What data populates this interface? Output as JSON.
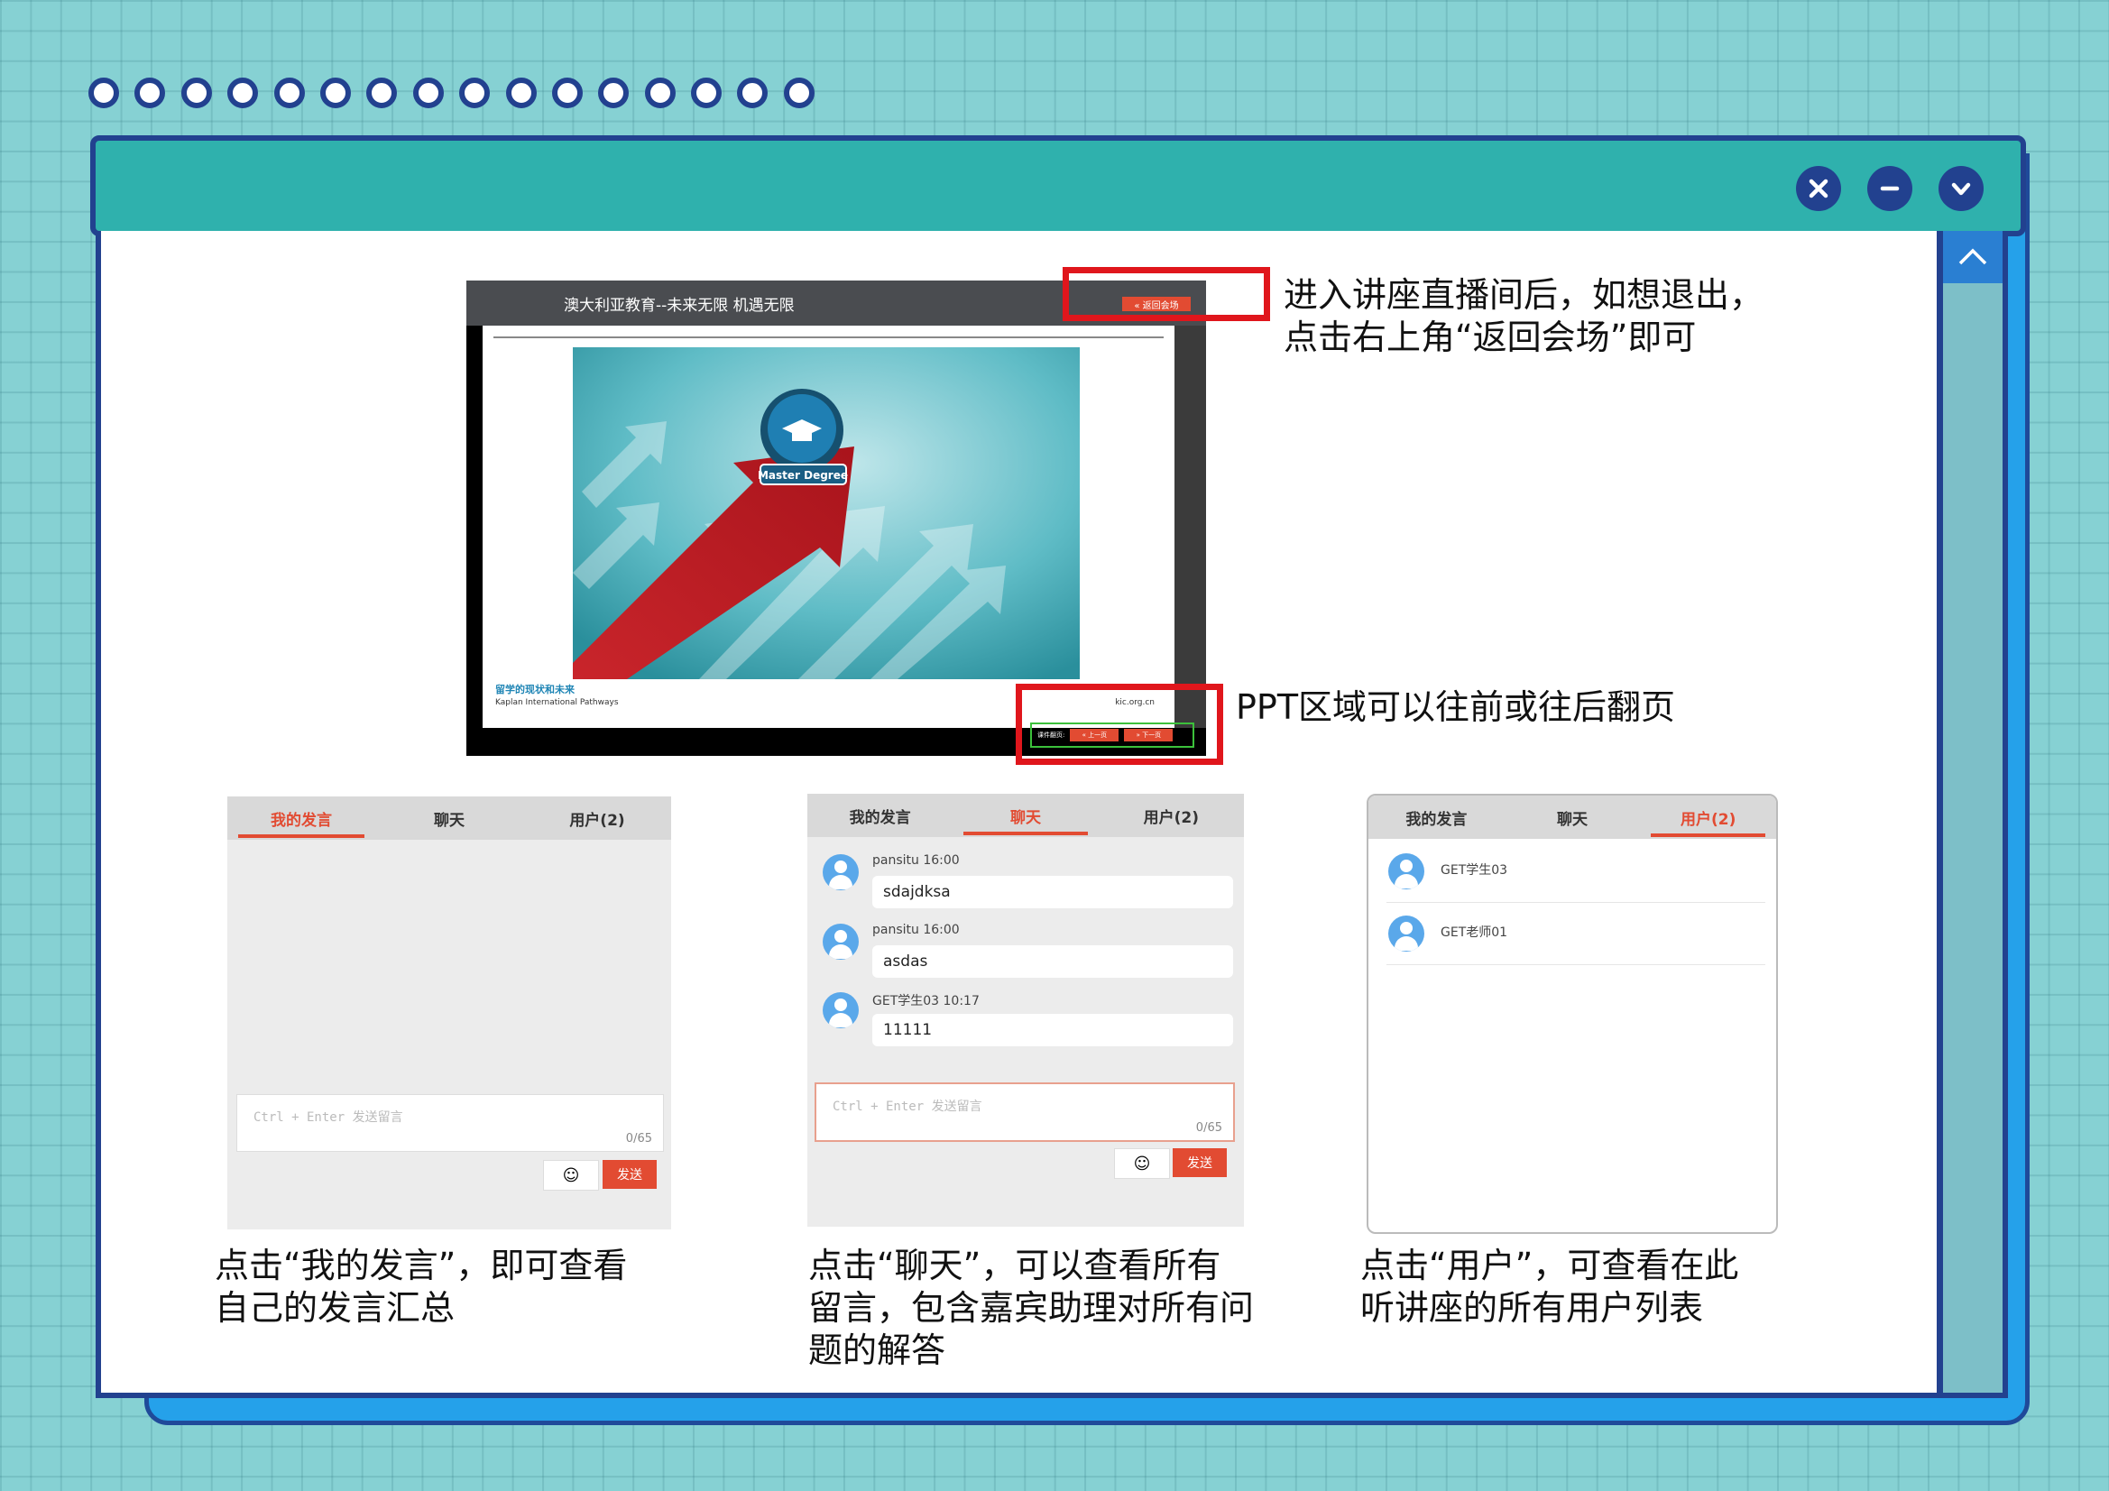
{
  "window": {
    "controls": [
      "close-icon",
      "minimize-icon",
      "chevron-down-icon"
    ],
    "accent": "#2fb1ad",
    "border": "#22418f"
  },
  "screenshot": {
    "title": "澳大利亚教育--未来无限 机遇无限",
    "back_button": "« 返回会场",
    "slide_badge": "Master Degree",
    "slide_subtitle": "留学的现状和未来",
    "slide_org": "Kaplan International Pathways",
    "slide_url": "kic.org.cn",
    "pager_label": "课件翻页:",
    "prev_button": "« 上一页",
    "next_button": "» 下一页"
  },
  "notes": {
    "exit": "进入讲座直播间后，如想退出，\n点击右上角“返回会场”即可",
    "ppt": "PPT区域可以往前或往后翻页",
    "my_posts": "点击“我的发言”，即可查看\n自己的发言汇总",
    "chat": "点击“聊天”，可以查看所有\n留言，包含嘉宾助理对所有问\n题的解答",
    "users": "点击“用户”，可查看在此\n听讲座的所有用户列表"
  },
  "tabs": {
    "my_posts": "我的发言",
    "chat": "聊天",
    "users": "用户(2)"
  },
  "input": {
    "placeholder": "Ctrl + Enter 发送留言",
    "count": "0/65",
    "emoji": "☺",
    "send": "发送"
  },
  "chat_messages": [
    {
      "meta": "pansitu 16:00",
      "text": "sdajdksa"
    },
    {
      "meta": "pansitu 16:00",
      "text": "asdas"
    },
    {
      "meta": "GET学生03 10:17",
      "text": "11111"
    }
  ],
  "user_list": [
    "GET学生03",
    "GET老师01"
  ]
}
